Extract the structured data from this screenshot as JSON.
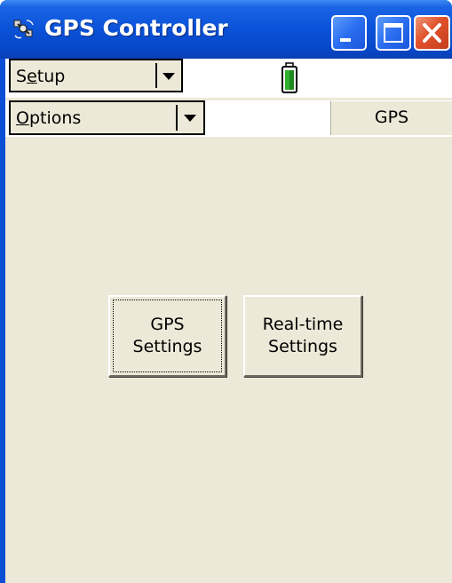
{
  "window": {
    "title": "GPS Controller",
    "colors": {
      "titlebar": "#0a52d8",
      "client_background": "#ece9d8",
      "close_button": "#e0512b",
      "battery": "#2fae2f"
    }
  },
  "toolbar_row1": {
    "setup_combo_label": "Setup",
    "battery_icon": "battery-icon"
  },
  "toolbar_row2": {
    "options_combo_label": "Options",
    "gps_tab_label": "GPS"
  },
  "main": {
    "gps_settings_label": "GPS\nSettings",
    "realtime_settings_label": "Real-time\nSettings"
  },
  "icons": {
    "app": "satellite-icon",
    "minimize": "minimize-icon",
    "maximize": "maximize-icon",
    "close": "close-icon",
    "dropdown": "chevron-down-icon"
  }
}
